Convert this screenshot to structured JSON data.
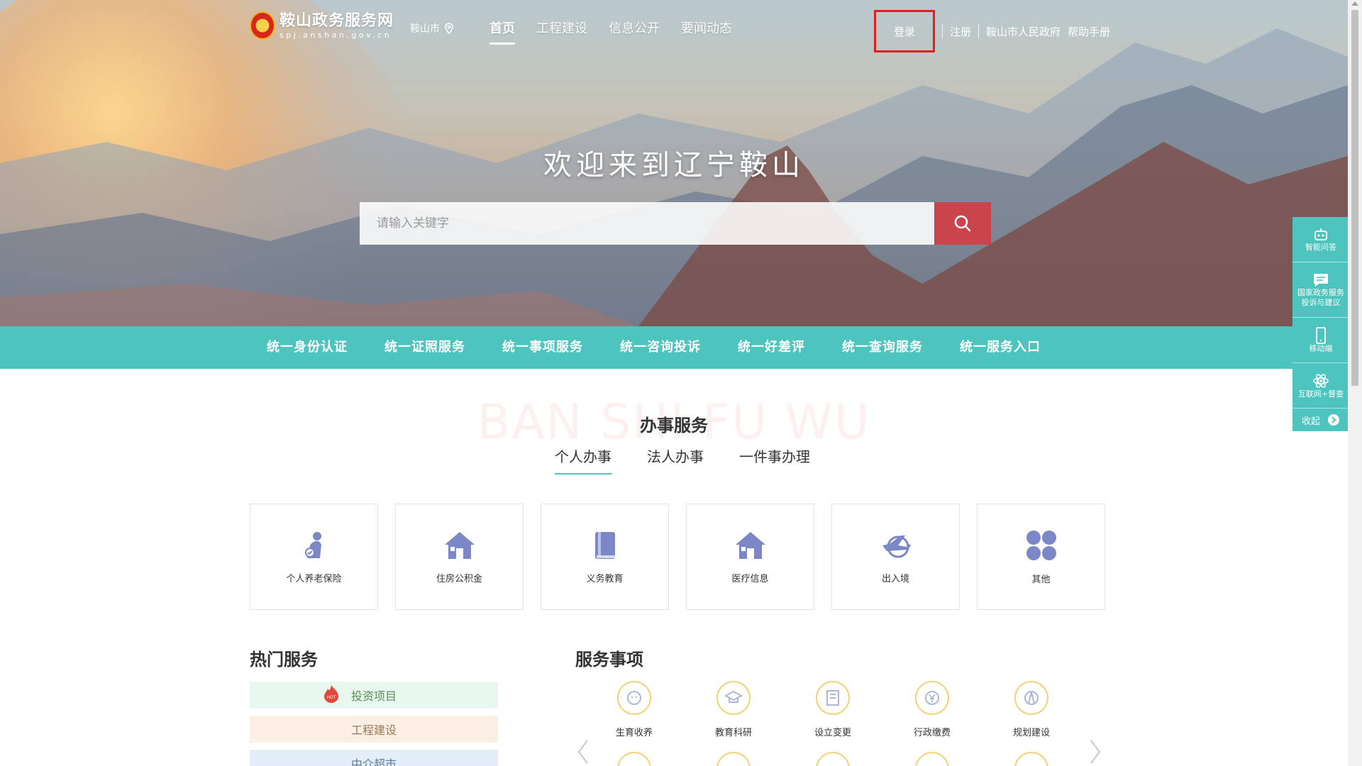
{
  "header": {
    "site_name": "鞍山政务服务网",
    "site_domain": "spj.anshan.gov.cn",
    "city": "鞍山市",
    "nav": [
      "首页",
      "工程建设",
      "信息公开",
      "要闻动态"
    ],
    "login": "登录",
    "register": "注册",
    "gov_link": "鞍山市人民政府",
    "help": "帮助手册"
  },
  "hero": {
    "title": "欢迎来到辽宁鞍山",
    "search_placeholder": "请输入关键字"
  },
  "unified_bar": [
    "统一身份认证",
    "统一证照服务",
    "统一事项服务",
    "统一咨询投诉",
    "统一好差评",
    "统一查询服务",
    "统一服务入口"
  ],
  "services": {
    "bg_word": "BAN SHI FU WU",
    "title": "办事服务",
    "tabs": [
      "个人办事",
      "法人办事",
      "一件事办理"
    ],
    "cards": [
      {
        "label": "个人养老保险",
        "icon": "elderly-person-icon"
      },
      {
        "label": "住房公积金",
        "icon": "house-icon"
      },
      {
        "label": "义务教育",
        "icon": "book-icon"
      },
      {
        "label": "医疗信息",
        "icon": "house-icon"
      },
      {
        "label": "出入境",
        "icon": "airplane-icon"
      },
      {
        "label": "其他",
        "icon": "four-leaf-icon"
      }
    ]
  },
  "hot": {
    "title": "热门服务",
    "badge": "HOT",
    "items": [
      "投资项目",
      "工程建设",
      "中介超市"
    ]
  },
  "service_items": {
    "title": "服务事项",
    "items": [
      "生育收养",
      "教育科研",
      "设立变更",
      "行政缴费",
      "规划建设"
    ]
  },
  "side_widget": {
    "items": [
      "智能问答",
      "国家政务服务\n投诉与建议",
      "移动端",
      "互联网+督查"
    ],
    "collapse": "收起"
  },
  "colors": {
    "teal": "#4dc4be",
    "search_button": "#c9444b",
    "card_icon": "#7b87c6",
    "login_highlight": "#e02020"
  }
}
